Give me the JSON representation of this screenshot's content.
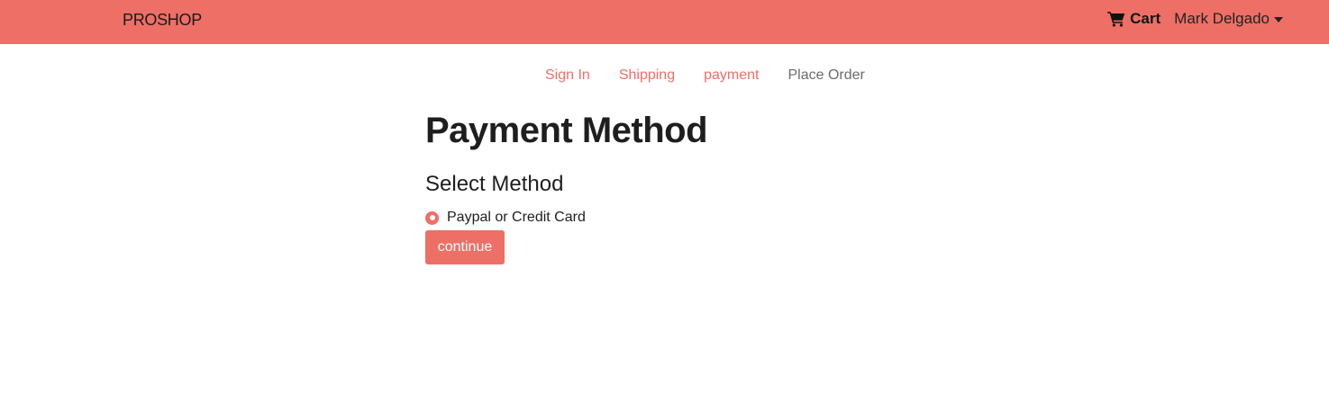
{
  "header": {
    "brand": "PROSHOP",
    "cart_label": "Cart",
    "cart_icon": "shopping-cart-icon",
    "user_name": "Mark Delgado",
    "accent_color": "#ee6f66"
  },
  "checkout_steps": [
    {
      "label": "Sign In",
      "enabled": true
    },
    {
      "label": "Shipping",
      "enabled": true
    },
    {
      "label": "payment",
      "enabled": true
    },
    {
      "label": "Place Order",
      "enabled": false
    }
  ],
  "main": {
    "title": "Payment Method",
    "select_label": "Select Method",
    "option_label": "Paypal or Credit Card",
    "option_selected": true,
    "continue_label": "continue"
  }
}
